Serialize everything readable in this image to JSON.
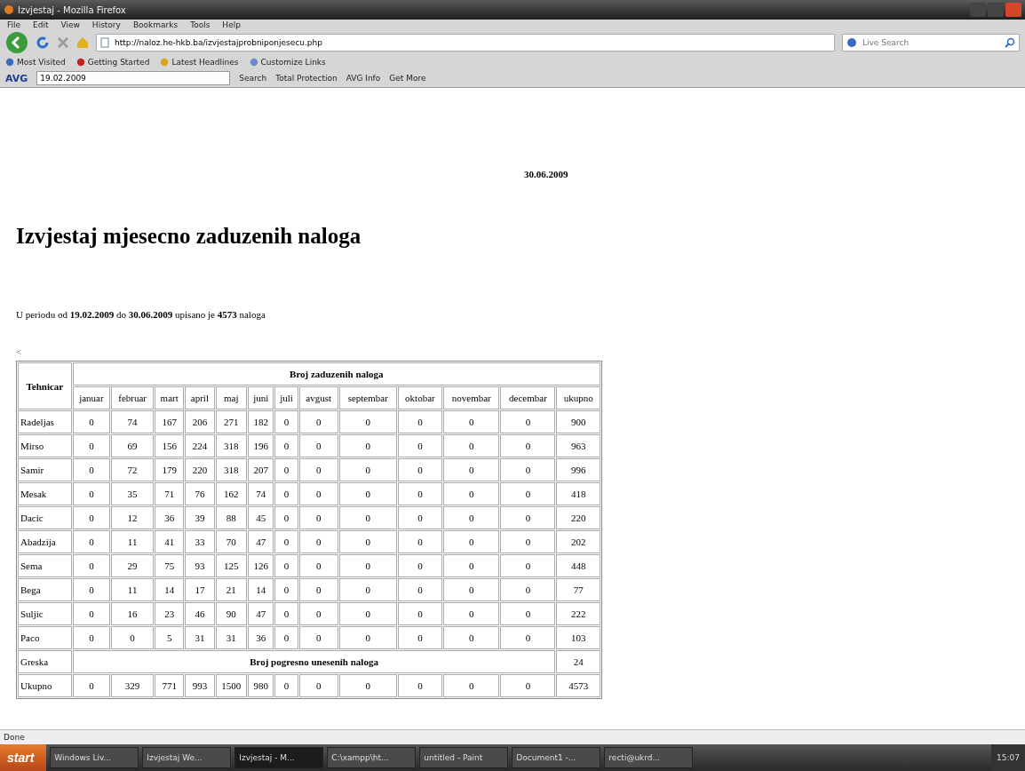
{
  "window": {
    "title": "Izvjestaj - Mozilla Firefox"
  },
  "menu": [
    "File",
    "Edit",
    "View",
    "History",
    "Bookmarks",
    "Tools",
    "Help"
  ],
  "address": {
    "value": "http://naloz.he-hkb.ba/izvjestajprobniponjesecu.php"
  },
  "search": {
    "placeholder": "Live Search"
  },
  "bookmarks": [
    "Most Visited",
    "Getting Started",
    "Latest Headlines",
    "Customize Links"
  ],
  "avg_toolbar": {
    "logo": "AVG",
    "field": "19.02.2009",
    "items": [
      "Search",
      "Total Protection",
      "AVG Info",
      "Get More"
    ]
  },
  "page": {
    "date": "30.06.2009",
    "heading": "Izvjestaj mjesecno zaduzenih naloga",
    "summary": "U periodu od **19.02.2009** do **30.06.2009** upisano je **4573** naloga",
    "back_link": "<"
  },
  "table": {
    "group": "Broj zaduzenih naloga",
    "columns": [
      "Tehnicar",
      "januar",
      "februar",
      "mart",
      "april",
      "maj",
      "juni",
      "juli",
      "avgust",
      "septembar",
      "oktobar",
      "novembar",
      "decembar",
      "ukupno"
    ],
    "rows": [
      [
        "Radeljas",
        "0",
        "74",
        "167",
        "206",
        "271",
        "182",
        "0",
        "0",
        "0",
        "0",
        "0",
        "0",
        "900"
      ],
      [
        "Mirso",
        "0",
        "69",
        "156",
        "224",
        "318",
        "196",
        "0",
        "0",
        "0",
        "0",
        "0",
        "0",
        "963"
      ],
      [
        "Samir",
        "0",
        "72",
        "179",
        "220",
        "318",
        "207",
        "0",
        "0",
        "0",
        "0",
        "0",
        "0",
        "996"
      ],
      [
        "Mesak",
        "0",
        "35",
        "71",
        "76",
        "162",
        "74",
        "0",
        "0",
        "0",
        "0",
        "0",
        "0",
        "418"
      ],
      [
        "Dacic",
        "0",
        "12",
        "36",
        "39",
        "88",
        "45",
        "0",
        "0",
        "0",
        "0",
        "0",
        "0",
        "220"
      ],
      [
        "Abadzija",
        "0",
        "11",
        "41",
        "33",
        "70",
        "47",
        "0",
        "0",
        "0",
        "0",
        "0",
        "0",
        "202"
      ],
      [
        "Sema",
        "0",
        "29",
        "75",
        "93",
        "125",
        "126",
        "0",
        "0",
        "0",
        "0",
        "0",
        "0",
        "448"
      ],
      [
        "Bega",
        "0",
        "11",
        "14",
        "17",
        "21",
        "14",
        "0",
        "0",
        "0",
        "0",
        "0",
        "0",
        "77"
      ],
      [
        "Suljic",
        "0",
        "16",
        "23",
        "46",
        "90",
        "47",
        "0",
        "0",
        "0",
        "0",
        "0",
        "0",
        "222"
      ],
      [
        "Paco",
        "0",
        "0",
        "5",
        "31",
        "31",
        "36",
        "0",
        "0",
        "0",
        "0",
        "0",
        "0",
        "103"
      ]
    ],
    "error_row": {
      "label": "Greska",
      "text": "Broj pogresno unesenih naloga",
      "total": "24"
    },
    "total_row": [
      "Ukupno",
      "0",
      "329",
      "771",
      "993",
      "1500",
      "980",
      "0",
      "0",
      "0",
      "0",
      "0",
      "0",
      "4573"
    ]
  },
  "status_bar": "Done",
  "taskbar": {
    "start": "start",
    "items": [
      {
        "label": "Windows Liv...",
        "selected": false
      },
      {
        "label": "Izvjestaj We...",
        "selected": false
      },
      {
        "label": "Izvjestaj - M...",
        "selected": true
      },
      {
        "label": "C:\\xampp\\ht...",
        "selected": false
      },
      {
        "label": "untitled - Paint",
        "selected": false
      },
      {
        "label": "Document1 -...",
        "selected": false
      },
      {
        "label": "recti@ukrd...",
        "selected": false
      }
    ],
    "clock": "15:07"
  }
}
